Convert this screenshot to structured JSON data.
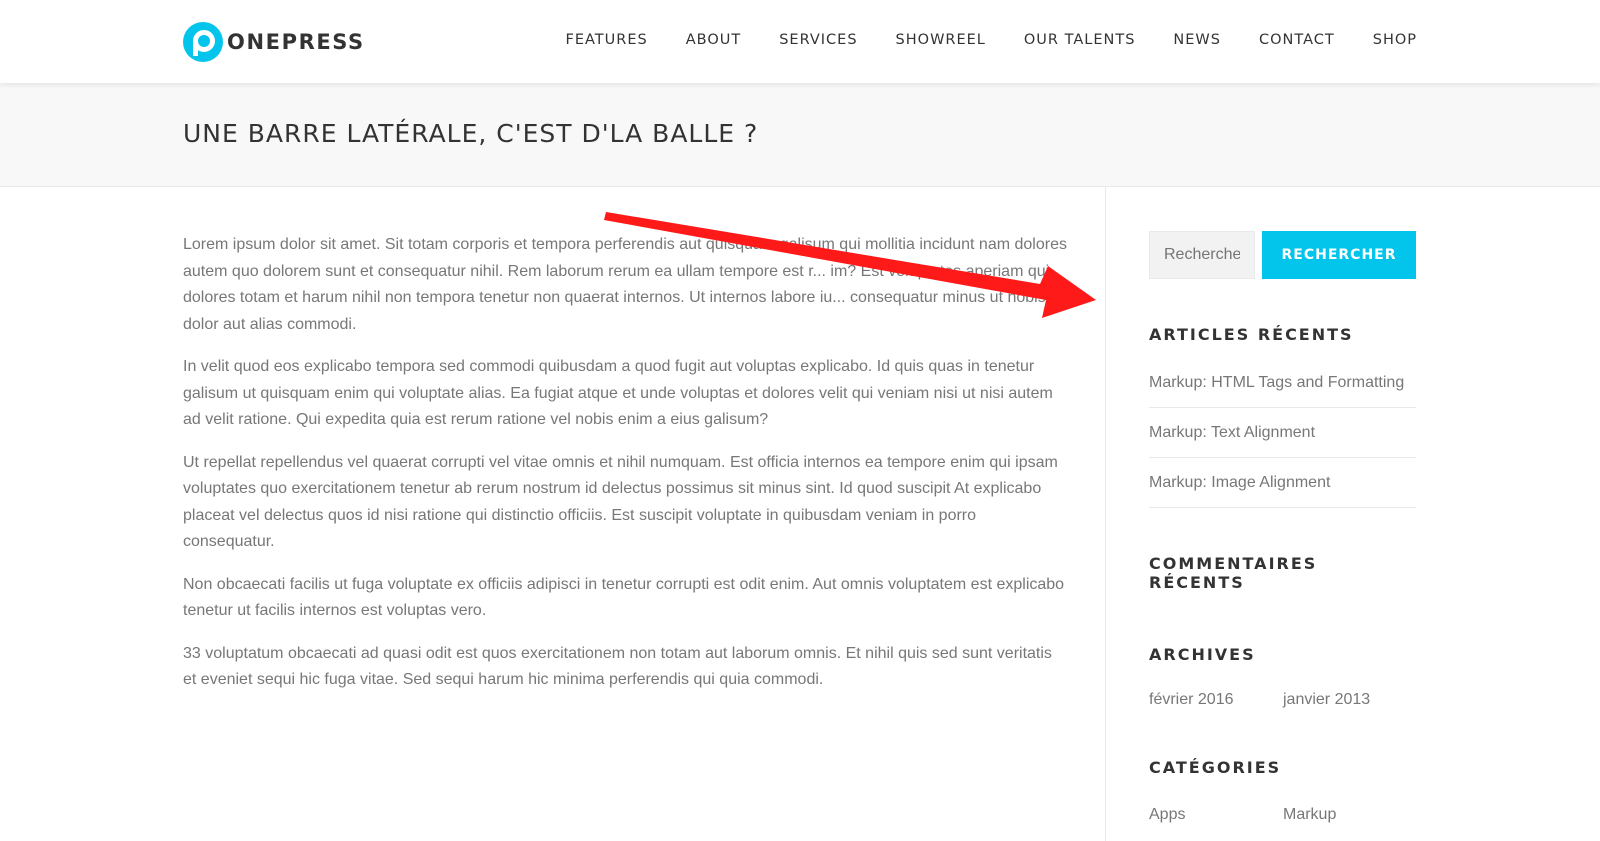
{
  "header": {
    "logo_text": "ONEPRESS",
    "nav": [
      {
        "label": "FEATURES"
      },
      {
        "label": "ABOUT"
      },
      {
        "label": "SERVICES"
      },
      {
        "label": "SHOWREEL"
      },
      {
        "label": "OUR TALENTS"
      },
      {
        "label": "NEWS"
      },
      {
        "label": "CONTACT"
      },
      {
        "label": "SHOP"
      }
    ]
  },
  "page": {
    "title": "UNE BARRE LATÉRALE, C'EST D'LA BALLE ?"
  },
  "content": {
    "paragraphs": [
      "Lorem ipsum dolor sit amet. Sit totam corporis et tempora perferendis aut quisquam galisum qui mollitia incidunt nam dolores autem quo dolorem sunt et consequatur nihil. Rem laborum rerum ea ullam tempore est r... im? Est voluptates aperiam qui dolores totam et harum nihil non tempora tenetur non quaerat internos. Ut internos labore iu... consequatur minus ut nobis dolor aut alias commodi.",
      "In velit quod eos explicabo tempora sed commodi quibusdam a quod fugit aut voluptas explicabo. Id quis quas in tenetur galisum ut quisquam enim qui voluptate alias. Ea fugiat atque et unde voluptas et dolores velit qui veniam nisi ut nisi autem ad velit ratione. Qui expedita quia est rerum ratione vel nobis enim a eius galisum?",
      "Ut repellat repellendus vel quaerat corrupti vel vitae omnis et nihil numquam. Est officia internos ea tempore enim qui ipsam voluptates quo exercitationem tenetur ab rerum nostrum id delectus possimus sit minus sint. Id quod suscipit At explicabo placeat vel delectus quos id nisi ratione qui distinctio officiis. Est suscipit voluptate in quibusdam veniam in porro consequatur.",
      "Non obcaecati facilis ut fuga voluptate ex officiis adipisci in tenetur corrupti est odit enim. Aut omnis voluptatem est explicabo tenetur ut facilis internos est voluptas vero.",
      "33 voluptatum obcaecati ad quasi odit est quos exercitationem non totam aut laborum omnis. Et nihil quis sed sunt veritatis et eveniet sequi hic fuga vitae. Sed sequi harum hic minima perferendis qui quia commodi."
    ]
  },
  "sidebar": {
    "search": {
      "placeholder": "Rechercher",
      "button_label": "RECHERCHER"
    },
    "recent_posts": {
      "title": "ARTICLES RÉCENTS",
      "items": [
        {
          "label": "Markup: HTML Tags and Formatting"
        },
        {
          "label": "Markup: Text Alignment"
        },
        {
          "label": "Markup: Image Alignment"
        }
      ]
    },
    "recent_comments": {
      "title": "COMMENTAIRES RÉCENTS"
    },
    "archives": {
      "title": "ARCHIVES",
      "items": [
        {
          "label": "février 2016"
        },
        {
          "label": "janvier 2013"
        }
      ]
    },
    "categories": {
      "title": "CATÉGORIES",
      "items": [
        {
          "label": "Apps"
        },
        {
          "label": "Markup"
        }
      ]
    }
  },
  "colors": {
    "accent": "#03c4eb",
    "annotation": "#ff1a1a"
  }
}
